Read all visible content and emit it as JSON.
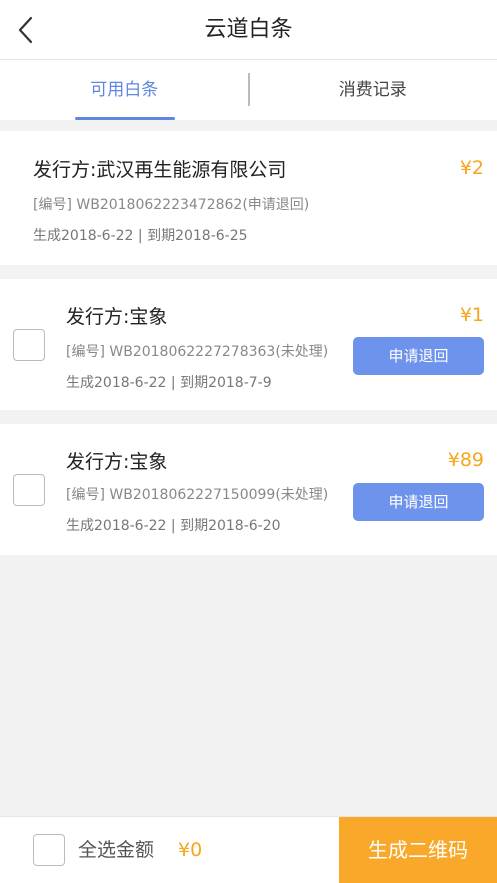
{
  "header": {
    "title": "云道白条",
    "back_icon": "chevron-left-icon"
  },
  "tabs": [
    {
      "label": "可用白条",
      "active": true
    },
    {
      "label": "消费记录",
      "active": false
    }
  ],
  "bills": [
    {
      "issuer": "发行方:武汉再生能源有限公司",
      "amount": "¥2",
      "bill_no": "[编号] WB2018062223472862(申请退回)",
      "dates": "生成2018-6-22 | 到期2018-6-25",
      "selectable": false
    },
    {
      "issuer": "发行方:宝象",
      "amount": "¥1",
      "bill_no": "[编号] WB2018062227278363(未处理)",
      "dates": "生成2018-6-22 | 到期2018-7-9",
      "selectable": true,
      "action_label": "申请退回"
    },
    {
      "issuer": "发行方:宝象",
      "amount": "¥89",
      "bill_no": "[编号] WB2018062227150099(未处理)",
      "dates": "生成2018-6-22 | 到期2018-6-20",
      "selectable": true,
      "action_label": "申请退回"
    }
  ],
  "footer": {
    "select_all_label": "全选金额",
    "total": "¥0",
    "generate_button": "生成二维码"
  },
  "colors": {
    "accent": "#5f86e0",
    "button_blue": "#6e93ec",
    "amount_orange": "#f7a619",
    "cta_orange": "#f9a82a"
  }
}
